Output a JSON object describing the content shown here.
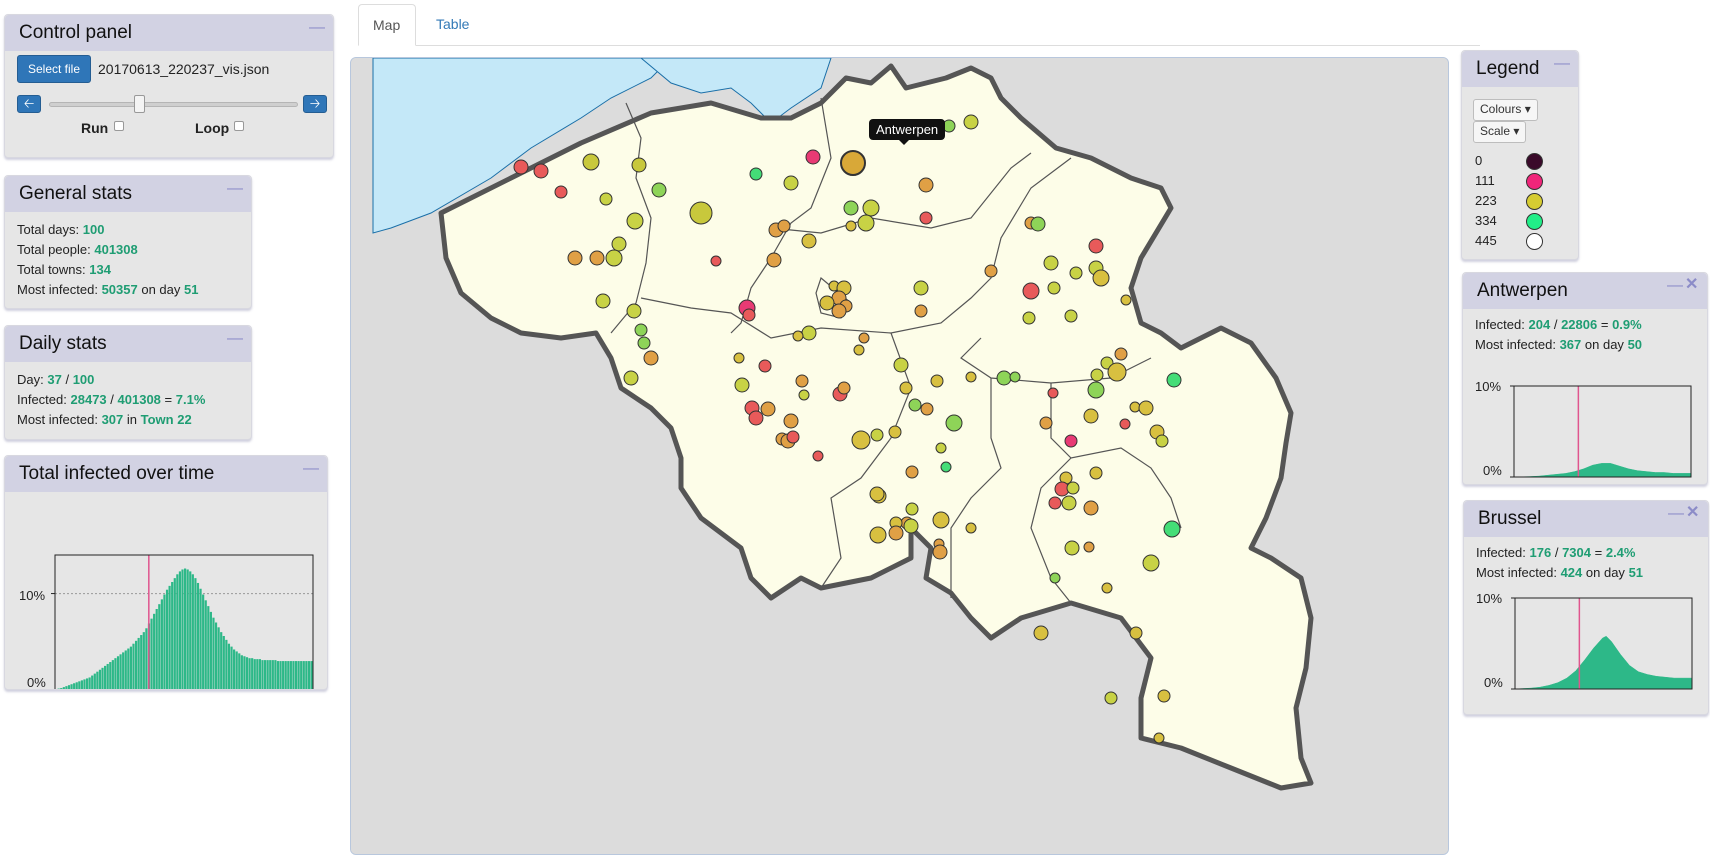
{
  "control_panel": {
    "title": "Control panel",
    "select_label": "Select file",
    "file_name": "20170613_220237_vis.json",
    "run_label": "Run",
    "loop_label": "Loop",
    "prev_icon": "arrow-left-icon",
    "next_icon": "arrow-right-icon",
    "run_checked": false,
    "loop_checked": false,
    "slider_day": 37
  },
  "general_stats": {
    "title": "General stats",
    "total_days_label": "Total days:",
    "total_days": "100",
    "total_people_label": "Total people:",
    "total_people": "401308",
    "total_towns_label": "Total towns:",
    "total_towns": "134",
    "most_infected_label": "Most infected:",
    "most_infected": "50357",
    "on_day_label": "on day",
    "most_infected_day": "51"
  },
  "daily_stats": {
    "title": "Daily stats",
    "day_label": "Day:",
    "day": "37",
    "day_sep": "/",
    "day_total": "100",
    "infected_label": "Infected:",
    "infected": "28473",
    "infected_sep": "/",
    "population": "401308",
    "eq": "=",
    "pct": "7.1%",
    "most_label": "Most infected:",
    "most": "307",
    "in_label": "in",
    "town": "Town 22"
  },
  "total_infected": {
    "title": "Total infected over time",
    "y_top": "10%",
    "y_bottom": "0%"
  },
  "tabs": [
    {
      "label": "Map",
      "active": true
    },
    {
      "label": "Table",
      "active": false
    }
  ],
  "map": {
    "tooltip": "Antwerpen",
    "colors": {
      "sea": "#c4e8f8",
      "land": "#fdfde8",
      "outside": "#dcdcdc",
      "border": "#555555"
    }
  },
  "legend": {
    "title": "Legend",
    "colours_label": "Colours",
    "scale_label": "Scale",
    "items": [
      {
        "value": "0",
        "color": "#3a0a2a"
      },
      {
        "value": "111",
        "color": "#f0257a"
      },
      {
        "value": "223",
        "color": "#d6cc32"
      },
      {
        "value": "334",
        "color": "#22ee88"
      },
      {
        "value": "445",
        "color": "#ffffff"
      }
    ]
  },
  "town_panels": [
    {
      "name": "Antwerpen",
      "infected_label": "Infected:",
      "infected": "204",
      "sep": "/",
      "population": "22806",
      "eq": "=",
      "pct": "0.9%",
      "most_label": "Most infected:",
      "most": "367",
      "on_day_label": "on day",
      "most_day": "50",
      "y_top": "10%",
      "y_bottom": "0%"
    },
    {
      "name": "Brussel",
      "infected_label": "Infected:",
      "infected": "176",
      "sep": "/",
      "population": "7304",
      "eq": "=",
      "pct": "2.4%",
      "most_label": "Most infected:",
      "most": "424",
      "on_day_label": "on day",
      "most_day": "51",
      "y_top": "10%",
      "y_bottom": "0%"
    }
  ],
  "chart_data": [
    {
      "type": "bar",
      "x": [
        1,
        2,
        3,
        4,
        5,
        6,
        7,
        8,
        9,
        10,
        11,
        12,
        13,
        14,
        15,
        16,
        17,
        18,
        19,
        20,
        21,
        22,
        23,
        24,
        25,
        26,
        27,
        28,
        29,
        30,
        31,
        32,
        33,
        34,
        35,
        36,
        37,
        38,
        39,
        40,
        41,
        42,
        43,
        44,
        45,
        46,
        47,
        48,
        49,
        50,
        51,
        52,
        53,
        54,
        55,
        56,
        57,
        58,
        59,
        60,
        61,
        62,
        63,
        64,
        65,
        66,
        67,
        68,
        69,
        70,
        71,
        72,
        73,
        74,
        75,
        76,
        77,
        78,
        79,
        80,
        81,
        82,
        83,
        84,
        85,
        86,
        87,
        88,
        89,
        90,
        91,
        92,
        93,
        94,
        95,
        96,
        97,
        98,
        99,
        100
      ],
      "values": [
        0.1,
        0.15,
        0.2,
        0.3,
        0.4,
        0.5,
        0.6,
        0.7,
        0.8,
        0.9,
        1.0,
        1.1,
        1.2,
        1.3,
        1.5,
        1.7,
        1.9,
        2.1,
        2.3,
        2.5,
        2.7,
        2.9,
        3.1,
        3.3,
        3.5,
        3.7,
        3.9,
        4.1,
        4.3,
        4.5,
        4.8,
        5.1,
        5.4,
        5.7,
        6.0,
        6.4,
        6.9,
        7.4,
        7.9,
        8.4,
        8.9,
        9.4,
        9.9,
        10.4,
        10.8,
        11.2,
        11.6,
        12.0,
        12.3,
        12.5,
        12.6,
        12.5,
        12.3,
        12.0,
        11.6,
        11.1,
        10.5,
        9.9,
        9.3,
        8.7,
        8.1,
        7.5,
        7.0,
        6.5,
        6.0,
        5.6,
        5.2,
        4.8,
        4.5,
        4.2,
        4.0,
        3.8,
        3.6,
        3.5,
        3.4,
        3.3,
        3.3,
        3.2,
        3.2,
        3.2,
        3.1,
        3.1,
        3.1,
        3.1,
        3.1,
        3.1,
        3.0,
        3.0,
        3.0,
        3.0,
        3.0,
        3.0,
        3.0,
        3.0,
        3.0,
        3.0,
        3.0,
        3.0,
        3.0,
        3.0
      ],
      "ylim": [
        0,
        14
      ],
      "yticks": [
        "0%",
        "10%"
      ],
      "current_day": 37,
      "color": "#2db888",
      "marker_color": "#e0558e"
    },
    {
      "type": "area",
      "x": [
        1,
        5,
        10,
        15,
        20,
        25,
        30,
        35,
        40,
        45,
        50,
        55,
        60,
        65,
        70,
        75,
        80,
        85,
        90,
        95,
        100
      ],
      "values": [
        0,
        0.02,
        0.05,
        0.1,
        0.2,
        0.3,
        0.4,
        0.6,
        0.9,
        1.3,
        1.5,
        1.5,
        1.2,
        0.9,
        0.7,
        0.6,
        0.5,
        0.5,
        0.4,
        0.4,
        0.4
      ],
      "ylim": [
        0,
        10
      ],
      "yticks": [
        "0%",
        "10%"
      ],
      "current_day": 37,
      "color": "#2db888",
      "marker_color": "#e0558e"
    },
    {
      "type": "area",
      "x": [
        1,
        5,
        10,
        15,
        20,
        25,
        30,
        35,
        40,
        45,
        50,
        52,
        55,
        60,
        65,
        70,
        75,
        80,
        85,
        90,
        95,
        100
      ],
      "values": [
        0,
        0.05,
        0.1,
        0.2,
        0.4,
        0.7,
        1.2,
        2.0,
        3.2,
        4.5,
        5.6,
        5.8,
        5.2,
        3.8,
        2.6,
        1.9,
        1.6,
        1.4,
        1.3,
        1.2,
        1.2,
        1.2
      ],
      "ylim": [
        0,
        10
      ],
      "yticks": [
        "0%",
        "10%"
      ],
      "current_day": 37,
      "color": "#2db888",
      "marker_color": "#e0558e"
    }
  ]
}
